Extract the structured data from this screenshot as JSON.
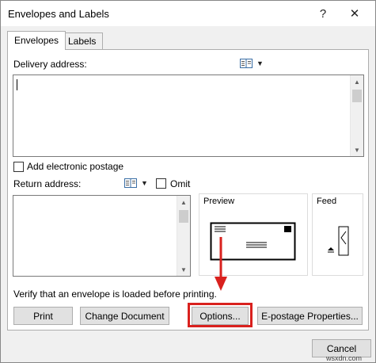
{
  "window": {
    "title": "Envelopes and Labels",
    "help_glyph": "?",
    "close_glyph": "✕"
  },
  "tabs": [
    {
      "label": "Envelopes",
      "active": true
    },
    {
      "label": "Labels",
      "active": false
    }
  ],
  "delivery": {
    "label": "Delivery address:",
    "value": ""
  },
  "electronic_postage": {
    "label": "Add electronic postage",
    "checked": false
  },
  "return": {
    "label": "Return address:",
    "value": "",
    "omit_label": "Omit",
    "omit_checked": false
  },
  "preview": {
    "label": "Preview"
  },
  "feed": {
    "label": "Feed"
  },
  "verify_message": "Verify that an envelope is loaded before printing.",
  "buttons": {
    "print": "Print",
    "change_document": "Change Document",
    "options": "Options...",
    "epostage_properties": "E-postage Properties...",
    "cancel": "Cancel"
  },
  "annotation": {
    "highlight_color": "#d9211e"
  },
  "watermark": "wsxdn.com"
}
